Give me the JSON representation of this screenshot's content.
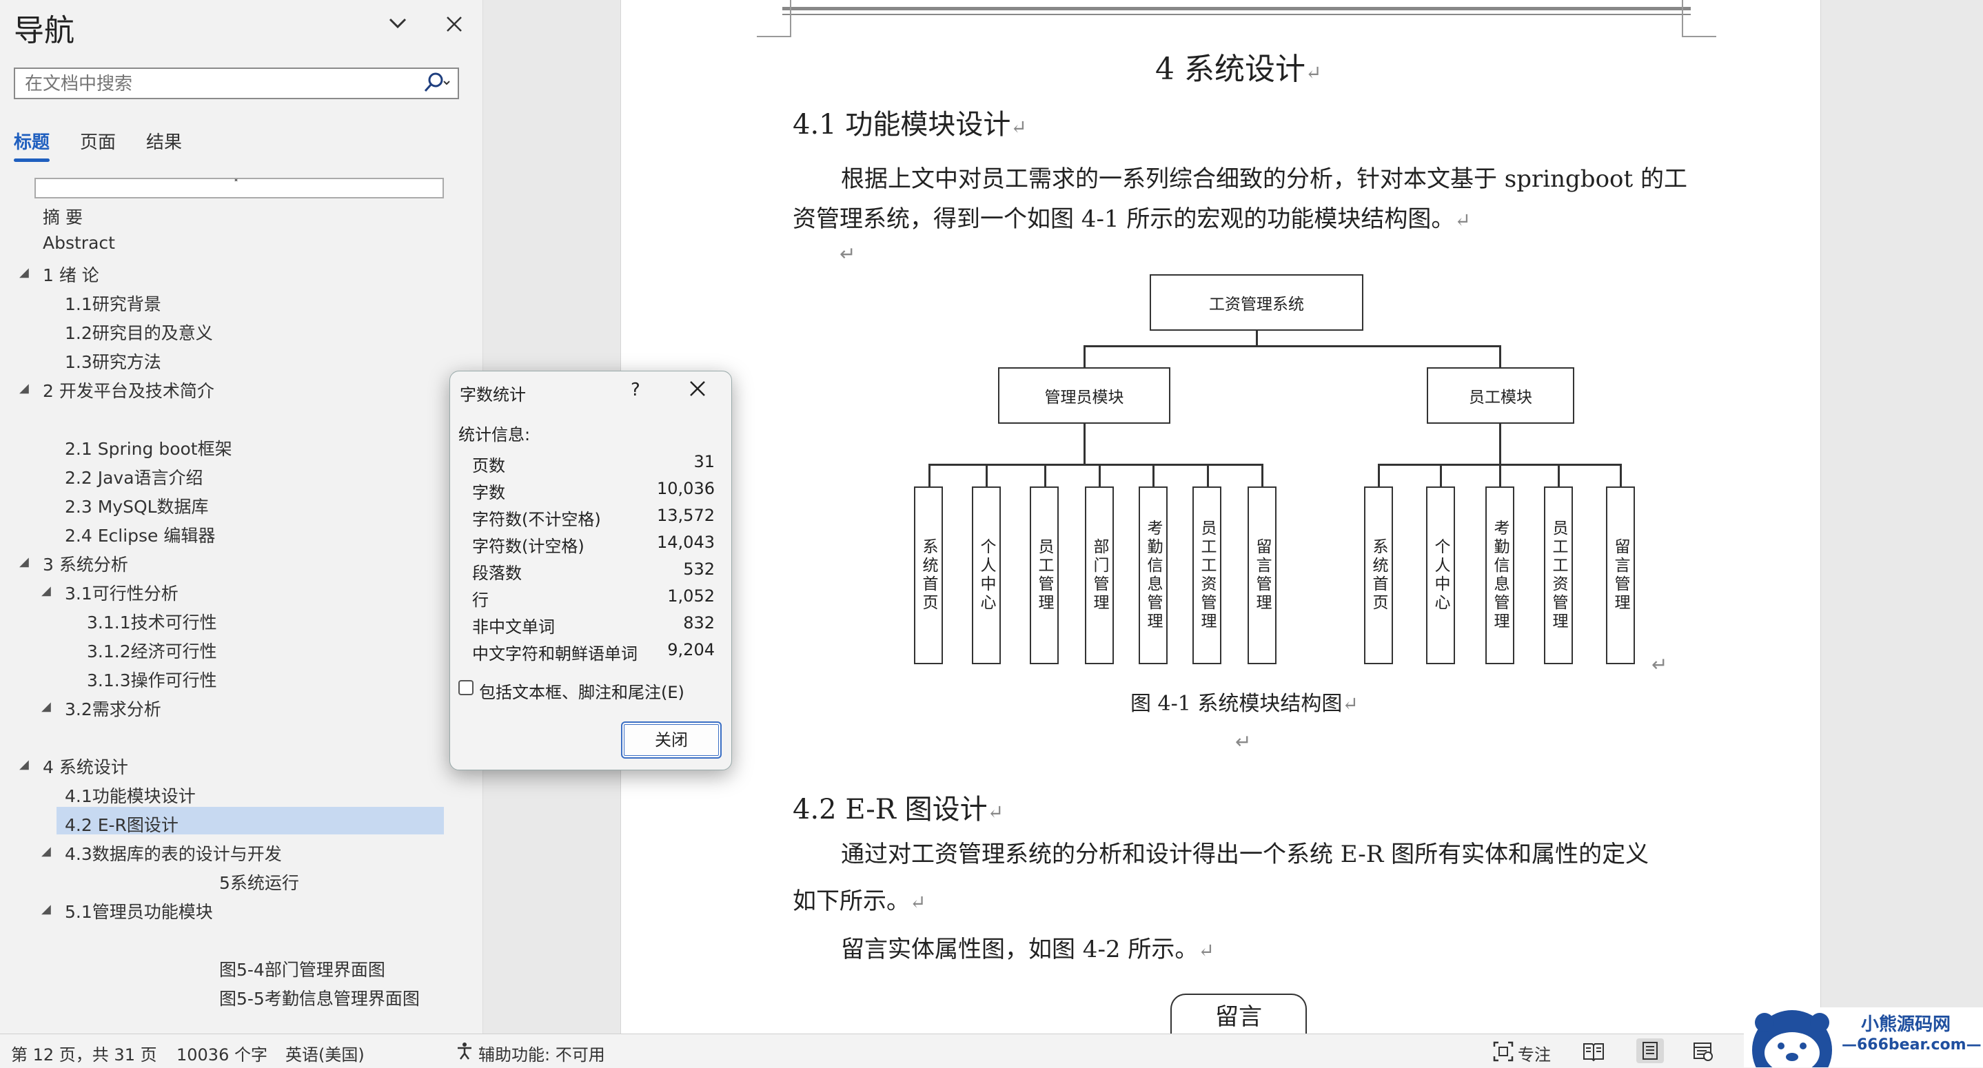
{
  "nav": {
    "title": "导航",
    "search_placeholder": "在文档中搜索",
    "tabs": [
      "标题",
      "页面",
      "结果"
    ],
    "empty_heading_marker": "˟",
    "items": [
      "摘  要",
      "Abstract",
      "1 绪  论",
      "1.1研究背景",
      "1.2研究目的及意义",
      "1.3研究方法",
      "2 开发平台及技术简介",
      "2.1 Spring boot框架",
      "2.2 Java语言介绍",
      "2.3   MySQL数据库",
      "2.4   Eclipse 编辑器",
      "3 系统分析",
      "3.1可行性分析",
      "3.1.1技术可行性",
      "3.1.2经济可行性",
      "3.1.3操作可行性",
      "3.2需求分析",
      "4 系统设计",
      "4.1功能模块设计",
      "4.2 E-R图设计",
      "4.3数据库的表的设计与开发",
      "5系统运行",
      "5.1管理员功能模块",
      "图5-4部门管理界面图",
      "图5-5考勤信息管理界面图"
    ],
    "selected_item": "4.2 E-R图设计"
  },
  "document": {
    "chapter_title": "4  系统设计",
    "section_41": "4.1 功能模块设计",
    "para1_line1": "根据上文中对员工需求的一系列综合细致的分析，针对本文基于 springboot 的工",
    "para1_line2": "资管理系统，得到一个如图 4-1 所示的宏观的功能模块结构图。",
    "return_mark": "↵",
    "diagram": {
      "root": "工资管理系统",
      "admin": "管理员模块",
      "staff": "员工模块",
      "admin_children": [
        "系统首页",
        "个人中心",
        "员工管理",
        "部门管理",
        "考勤信息管理",
        "员工工资管理",
        "留言管理"
      ],
      "staff_children": [
        "系统首页",
        "个人中心",
        "考勤信息管理",
        "员工工资管理",
        "留言管理"
      ]
    },
    "figure_caption": "图 4-1  系统模块结构图",
    "section_42": "4.2  E-R 图设计",
    "para2_line1": "通过对工资管理系统的分析和设计得出一个系统  E-R  图所有实体和属性的定义",
    "para2_line2": "如下所示。",
    "para3": "留言实体属性图，如图 4-2 所示。",
    "entity_box": "留言"
  },
  "dialog": {
    "title": "字数统计",
    "help": "?",
    "section_label": "统计信息:",
    "stats": [
      {
        "label": "页数",
        "value": "31"
      },
      {
        "label": "字数",
        "value": "10,036"
      },
      {
        "label": "字符数(不计空格)",
        "value": "13,572"
      },
      {
        "label": "字符数(计空格)",
        "value": "14,043"
      },
      {
        "label": "段落数",
        "value": "532"
      },
      {
        "label": "行",
        "value": "1,052"
      },
      {
        "label": "非中文单词",
        "value": "832"
      },
      {
        "label": "中文字符和朝鲜语单词",
        "value": "9,204"
      }
    ],
    "checkbox_label": "包括文本框、脚注和尾注(E)",
    "checkbox_checked": false,
    "close_button": "关闭"
  },
  "status_bar": {
    "page": "第 12 页，共 31 页",
    "words": "10036 个字",
    "language": "英语(美国)",
    "accessibility": "辅助功能: 不可用",
    "focus": "专注"
  },
  "watermark": {
    "line1": "小熊源码网",
    "line2": "—666bear.com—"
  }
}
